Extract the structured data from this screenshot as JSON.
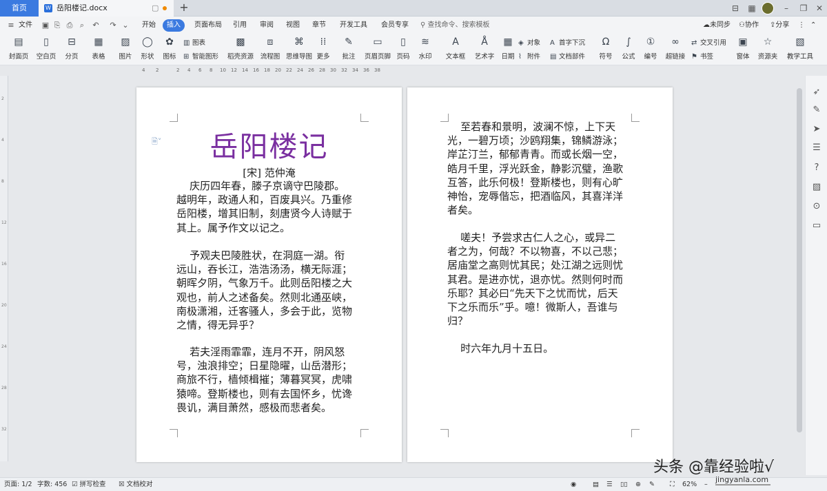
{
  "titlebar": {
    "home_tab": "首页",
    "doc_tab": "岳阳楼记.docx",
    "doc_icon": "W",
    "new_tab": "+"
  },
  "menubar": {
    "file": "文件",
    "tabs": [
      "开始",
      "插入",
      "页面布局",
      "引用",
      "审阅",
      "视图",
      "章节",
      "开发工具",
      "会员专享"
    ],
    "search_placeholder": "查找命令、搜索模板",
    "sync": "未同步",
    "collab": "协作",
    "share": "分享"
  },
  "ribbon": {
    "large": [
      "封面页",
      "空白页",
      "分页",
      "表格",
      "图片",
      "形状",
      "图标",
      "稻壳资源",
      "流程图",
      "思维导图",
      "更多",
      "批注",
      "页眉页脚",
      "页码",
      "水印",
      "文本框",
      "艺术字",
      "日期",
      "符号",
      "公式",
      "编号",
      "超链接",
      "窗体",
      "资源夹",
      "教学工具"
    ],
    "small": {
      "chart": "图表",
      "smart": "智能图形",
      "object": "对象",
      "attachment": "附件",
      "dropcap": "首字下沉",
      "docparts": "文档部件",
      "crossref": "交叉引用",
      "bookmark": "书签"
    }
  },
  "ruler_marks": [
    "4",
    "2",
    "2",
    "4",
    "6",
    "8",
    "10",
    "12",
    "14",
    "16",
    "18",
    "20",
    "22",
    "24",
    "26",
    "28",
    "30",
    "32",
    "34",
    "36",
    "38"
  ],
  "document": {
    "title": "岳阳楼记",
    "author": "[宋] 范仲淹",
    "page1_paragraphs": [
      "    庆历四年春，滕子京谪守巴陵郡。\n越明年，政通人和，百废具兴。乃重修\n岳阳楼，增其旧制，刻唐贤今人诗赋于\n其上。属予作文以记之。",
      "    予观夫巴陵胜状，在洞庭一湖。衔\n远山，吞长江，浩浩汤汤，横无际涯；\n朝晖夕阴，气象万千。此则岳阳楼之大\n观也，前人之述备矣。然则北通巫峡，\n南极潇湘，迁客骚人，多会于此，览物\n之情，得无异乎？",
      "    若夫淫雨霏霏，连月不开，阴风怒\n号，浊浪排空；日星隐曜，山岳潜形；\n商旅不行，樯倾楫摧；薄暮冥冥，虎啸\n猿啼。登斯楼也，则有去国怀乡，忧谗\n畏讥，满目萧然，感极而悲者矣。"
    ],
    "page2_paragraphs": [
      "    至若春和景明，波澜不惊，上下天\n光，一碧万顷；沙鸥翔集，锦鳞游泳；\n岸芷汀兰，郁郁青青。而或长烟一空，\n皓月千里，浮光跃金，静影沉璧，渔歌\n互答，此乐何极！登斯楼也，则有心旷\n神怡，宠辱偕忘，把酒临风，其喜洋洋\n者矣。",
      "    嗟夫！予尝求古仁人之心，或异二\n者之为，何哉？不以物喜，不以己悲；\n居庙堂之高则忧其民；处江湖之远则忧\n其君。是进亦忧，退亦忧。然则何时而\n乐耶？其必曰“先天下之忧而忧，后天\n下之乐而乐”乎。噫！微斯人，吾谁与\n归？",
      "    时六年九月十五日。"
    ]
  },
  "statusbar": {
    "page": "页面: 1/2",
    "words": "字数: 456",
    "spell": "拼写检查",
    "proof": "文档校对",
    "zoom": "62%"
  },
  "watermark": {
    "text": "头条 @靠经验啦√",
    "site": "jingyanla.com"
  },
  "colors": {
    "accent": "#3b7ae0",
    "title_purple": "#7a2fa0"
  }
}
